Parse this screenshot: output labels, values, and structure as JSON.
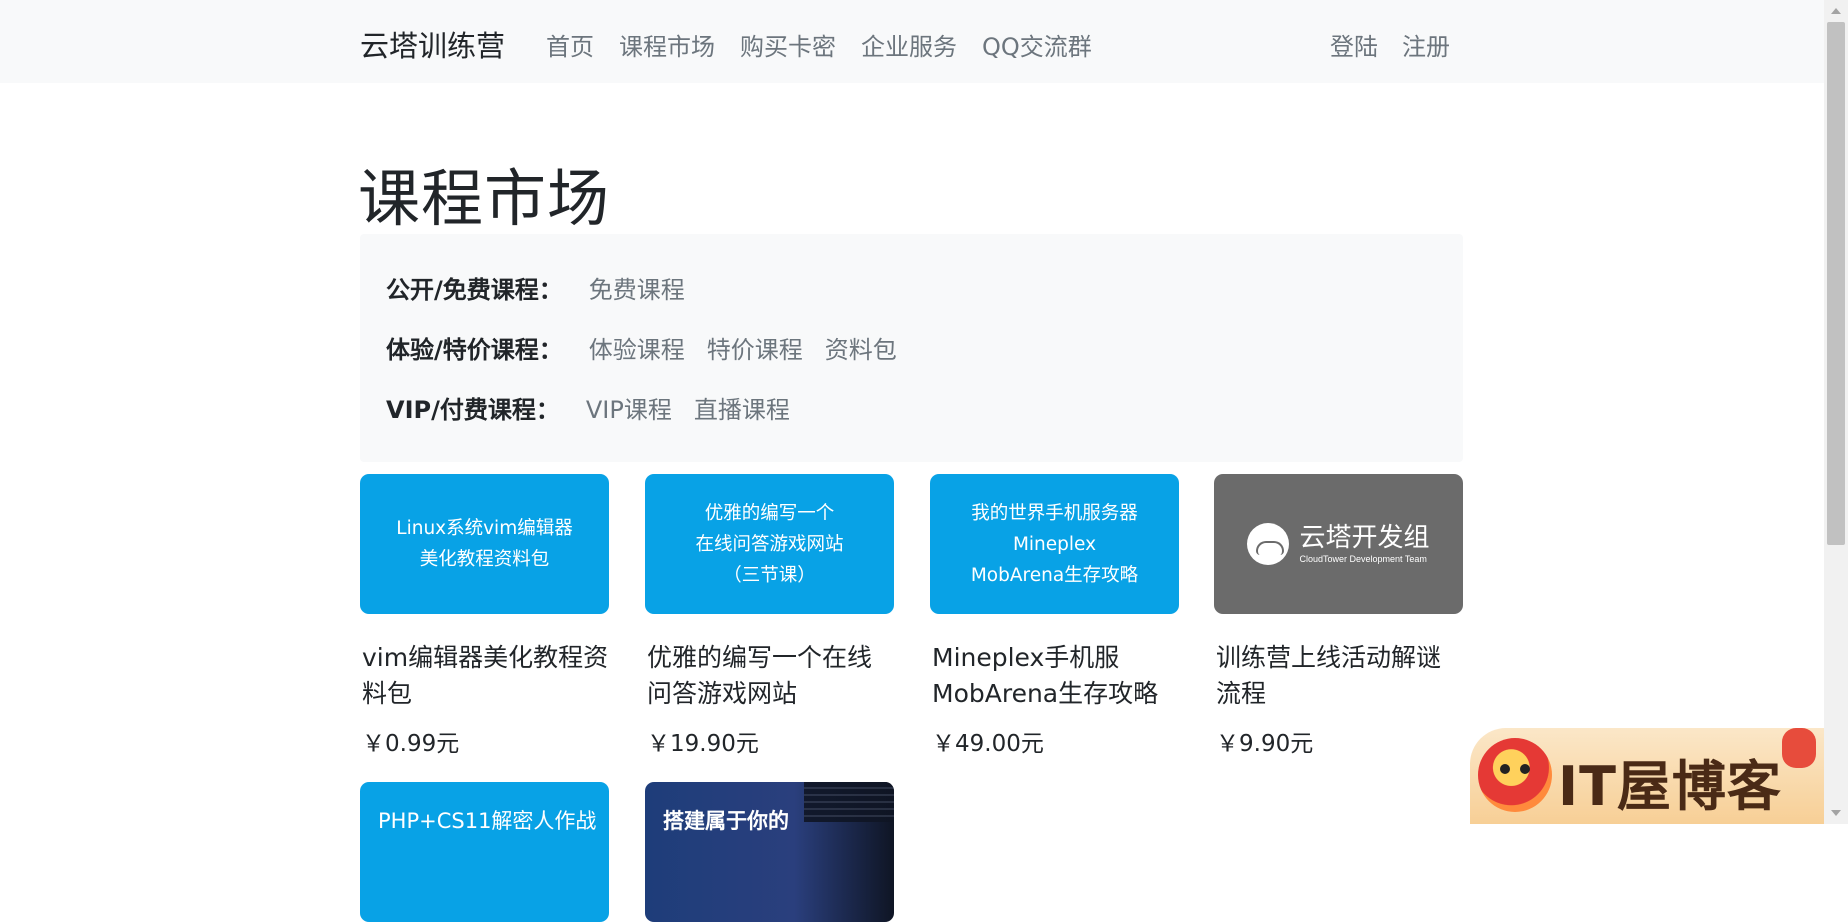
{
  "navbar": {
    "brand": "云塔训练营",
    "links": [
      "首页",
      "课程市场",
      "购买卡密",
      "企业服务",
      "QQ交流群"
    ],
    "login": "登陆",
    "register": "注册"
  },
  "page_title": "课程市场",
  "filters": [
    {
      "label": "公开/免费课程：",
      "items": [
        "免费课程"
      ]
    },
    {
      "label": "体验/特价课程：",
      "items": [
        "体验课程",
        "特价课程",
        "资料包"
      ]
    },
    {
      "label": "VIP/付费课程：",
      "items": [
        "VIP课程",
        "直播课程"
      ]
    }
  ],
  "courses": [
    {
      "thumb_text": "Linux系统vim编辑器\n美化教程资料包",
      "title": "vim编辑器美化教程资料包",
      "price": "￥0.99元"
    },
    {
      "thumb_text": "优雅的编写一个\n在线问答游戏网站\n（三节课）",
      "title": "优雅的编写一个在线问答游戏网站",
      "price": "￥19.90元"
    },
    {
      "thumb_text": "我的世界手机服务器\nMineplex\nMobArena生存攻略",
      "title": "Mineplex手机服MobArena生存攻略",
      "price": "￥49.00元"
    },
    {
      "logo_name": "云塔开发组",
      "logo_sub": "CloudTower Development Team",
      "title": "训练营上线活动解谜流程",
      "price": "￥9.90元"
    }
  ],
  "partial_courses": [
    {
      "thumb_text": "PHP+CS11解密人作战"
    },
    {
      "thumb_text": "搭建属于你的"
    }
  ],
  "watermark": {
    "text": "IT屋博客"
  },
  "colors": {
    "navbar_bg": "#f8f9fa",
    "card_blue": "#08a2e6",
    "card_gray": "#6b6b6b",
    "text_muted": "#6c757d"
  }
}
